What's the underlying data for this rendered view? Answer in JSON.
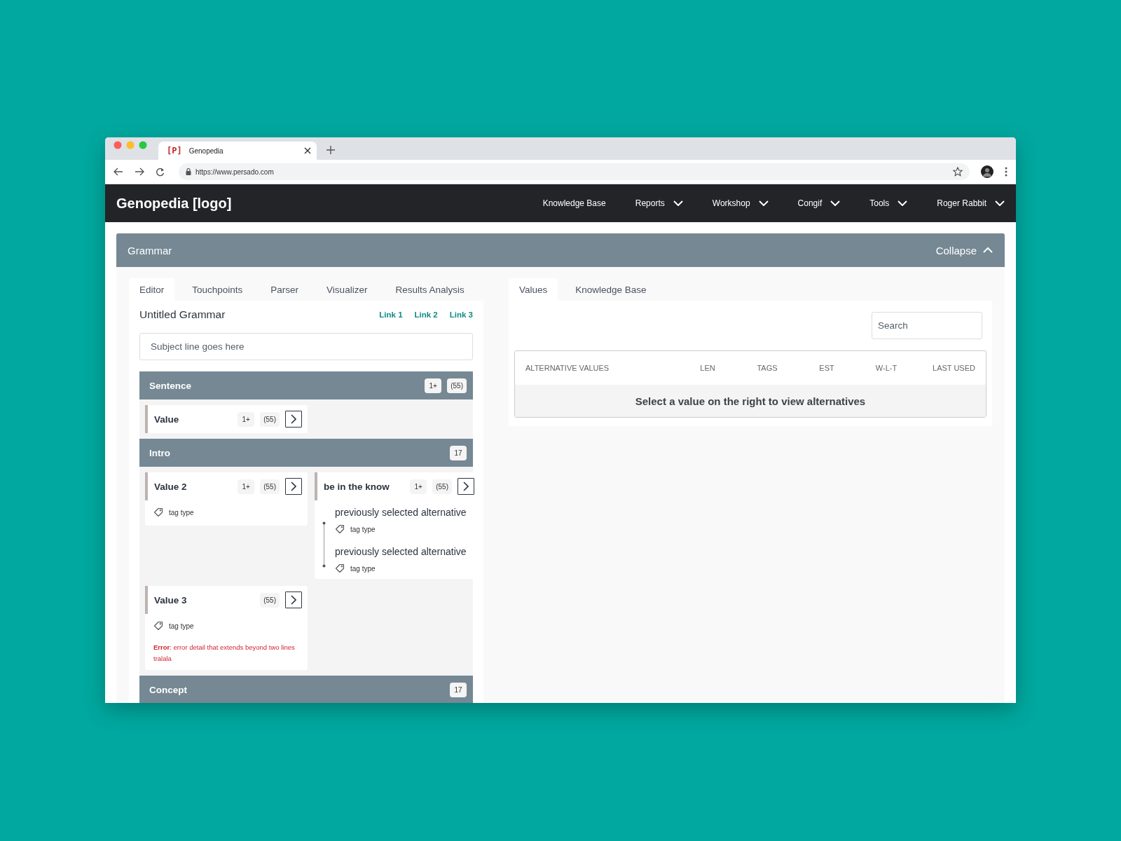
{
  "browser": {
    "tab_title": "Genopedia",
    "favicon": "[P]",
    "url": "https://www.persado.com"
  },
  "app": {
    "logo": "Genopedia [logo]",
    "nav": [
      {
        "label": "Knowledge Base",
        "dropdown": false
      },
      {
        "label": "Reports",
        "dropdown": true
      },
      {
        "label": "Workshop",
        "dropdown": true
      },
      {
        "label": "Congif",
        "dropdown": true
      },
      {
        "label": "Tools",
        "dropdown": true
      },
      {
        "label": "Roger Rabbit",
        "dropdown": true
      }
    ]
  },
  "panel": {
    "title": "Grammar",
    "collapse_label": "Collapse",
    "expanded": true
  },
  "editor": {
    "tabs": [
      {
        "label": "Editor",
        "selected": true
      },
      {
        "label": "Touchpoints",
        "selected": false
      },
      {
        "label": "Parser",
        "selected": false
      },
      {
        "label": "Visualizer",
        "selected": false
      },
      {
        "label": "Results Analysis",
        "selected": false
      }
    ],
    "title": "Untitled Grammar",
    "links": [
      "Link 1",
      "Link 2",
      "Link 3"
    ],
    "subject_field": {
      "placeholder": "Subject line goes here"
    },
    "sections": [
      {
        "title": "Sentence",
        "badges": [
          "1+",
          "(55)"
        ],
        "values": [
          {
            "title": "Value",
            "badges": [
              "1+",
              "(55)"
            ]
          }
        ]
      },
      {
        "title": "Intro",
        "badges": [
          "17"
        ],
        "values": [
          {
            "title": "Value 2",
            "badges": [
              "1+",
              "(55)"
            ],
            "tags": [
              "tag type"
            ]
          },
          {
            "title": "be in the know",
            "badges": [
              "1+",
              "(55)"
            ],
            "alternatives": [
              {
                "text": "previously selected alternative",
                "tag": "tag type"
              },
              {
                "text": "previously selected alternative",
                "tag": "tag type"
              }
            ]
          },
          {
            "title": "Value 3",
            "badges": [
              "(55)"
            ],
            "tags": [
              "tag type"
            ],
            "error": "**Error**: error detail that extends beyond two lines tralala"
          }
        ]
      },
      {
        "title": "Concept",
        "badges": [
          "17"
        ]
      }
    ]
  },
  "values_panel": {
    "tabs": [
      {
        "label": "Values",
        "selected": true
      },
      {
        "label": "Knowledge Base",
        "selected": false
      }
    ],
    "search": {
      "placeholder": "Search"
    },
    "table": {
      "columns": [
        "ALTERNATIVE VALUES",
        "LEN",
        "TAGS",
        "EST",
        "W-L-T",
        "LAST USED"
      ],
      "empty_message": "Select a value on the right to view alternatives"
    }
  }
}
